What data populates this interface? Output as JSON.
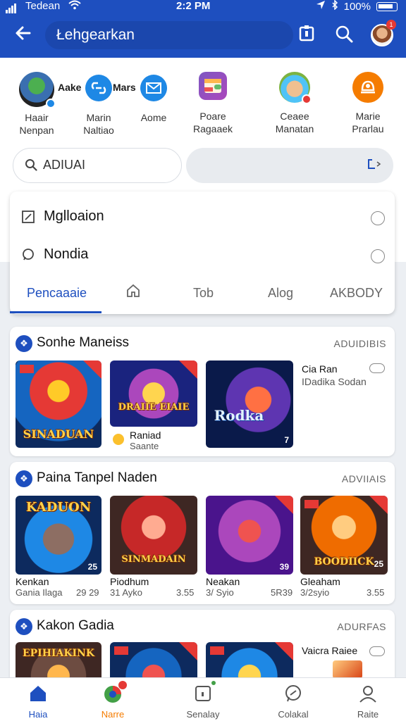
{
  "status_bar": {
    "carrier": "Tedean",
    "time": "2:2 PM",
    "battery": "100%"
  },
  "header": {
    "search_text": "Łehgearkan"
  },
  "stories": [
    {
      "line1": "Haair",
      "line2": "Nenpan",
      "tag": "Aake"
    },
    {
      "line1": "Marin",
      "line2": "Naltiao",
      "tag": "Mars"
    },
    {
      "line1": "Aome",
      "line2": ""
    },
    {
      "line1": "Poare",
      "line2": "Ragaaek"
    },
    {
      "line1": "Ceaee",
      "line2": "Manatan"
    },
    {
      "line1": "Marie",
      "line2": "Prarlau"
    }
  ],
  "search": {
    "value": "ADIUAI"
  },
  "dropdown": {
    "items": [
      {
        "label": "Mglloaion"
      },
      {
        "label": "Nondia"
      }
    ],
    "tabs": [
      "Pencaaaie",
      "",
      "Tob",
      "Alog",
      "AKBODY"
    ]
  },
  "sections": [
    {
      "title": "Sonhe Maneiss",
      "action": "ADUIDIBIS",
      "items": [
        {
          "art_title": "SINADUAN",
          "num": ""
        },
        {
          "art_title": "DRAIIE EIAIE",
          "caption1": "Raniad",
          "caption2": "Saante"
        },
        {
          "art_title": "Rodka",
          "num": "7"
        }
      ],
      "side_title": "Cia Ran",
      "side_sub": "IDadika Sodan"
    },
    {
      "title": "Paina Tanpel Naden",
      "action": "ADVIIAIS",
      "items": [
        {
          "art_title": "KADUON",
          "num": "25",
          "name": "Kenkan",
          "sub": "Gania Ilaga",
          "price": "29 29"
        },
        {
          "art_title": "SINMADAIN",
          "num": "",
          "name": "Piodhum",
          "sub": "31 Ayko",
          "price": "3.55"
        },
        {
          "art_title": "",
          "num": "39",
          "name": "Neakan",
          "sub": "3/ Syio",
          "price": "5R39"
        },
        {
          "art_title": "BOODIICK",
          "num": "25",
          "name": "Gleaham",
          "sub": "3/2syio",
          "price": "3.55"
        }
      ]
    },
    {
      "title": "Kakon Gadia",
      "action": "ADURFAS",
      "items": [
        {
          "art_title": "EPIHIAKINK"
        },
        {
          "art_title": ""
        },
        {
          "art_title": ""
        }
      ],
      "side_title": "Vaicra Raiee"
    }
  ],
  "bottom_nav": [
    {
      "label": "Haia"
    },
    {
      "label": "Narre"
    },
    {
      "label": "Senalay"
    },
    {
      "label": "Colakal"
    },
    {
      "label": "Raite"
    }
  ],
  "colors": {
    "primary": "#1e4fbf",
    "accent_orange": "#f57c00",
    "badge_red": "#e53935"
  }
}
